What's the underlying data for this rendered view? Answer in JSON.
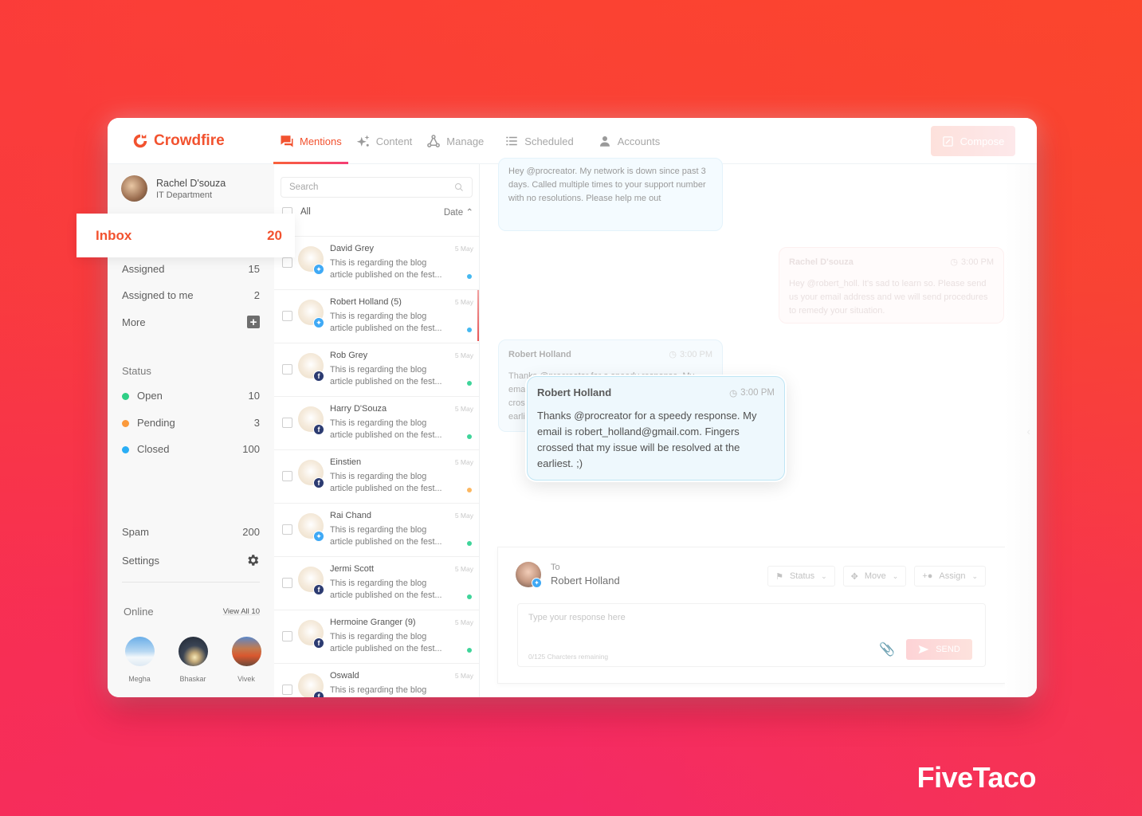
{
  "app": {
    "name": "Crowdfire",
    "nav": [
      {
        "label": "Mentions",
        "icon": "chat-bubbles-icon",
        "active": true
      },
      {
        "label": "Content",
        "icon": "sparkle-icon",
        "active": false
      },
      {
        "label": "Manage",
        "icon": "network-icon",
        "active": false
      },
      {
        "label": "Scheduled",
        "icon": "list-icon",
        "active": false
      },
      {
        "label": "Accounts",
        "icon": "user-icon",
        "active": false
      }
    ],
    "compose_label": "Compose"
  },
  "user": {
    "name": "Rachel D'souza",
    "department": "IT Department"
  },
  "sidebar": {
    "inbox": {
      "label": "Inbox",
      "count": "20"
    },
    "items": [
      {
        "label": "Assigned",
        "count": "15"
      },
      {
        "label": "Assigned to me",
        "count": "2"
      },
      {
        "label": "More",
        "count": "+"
      }
    ],
    "status_heading": "Status",
    "statuses": [
      {
        "label": "Open",
        "count": "10",
        "color": "#2fcf86"
      },
      {
        "label": "Pending",
        "count": "3",
        "color": "#fb9a3c"
      },
      {
        "label": "Closed",
        "count": "100",
        "color": "#2aaef5"
      }
    ],
    "spam": {
      "label": "Spam",
      "count": "200"
    },
    "settings": {
      "label": "Settings"
    },
    "online": {
      "label": "Online",
      "view_all": "View All 10",
      "users": [
        {
          "name": "Megha"
        },
        {
          "name": "Bhaskar"
        },
        {
          "name": "Vivek"
        }
      ]
    }
  },
  "list": {
    "search_placeholder": "Search",
    "all_label": "All",
    "sort_label": "Date",
    "messages": [
      {
        "name": "David Grey",
        "date": "5 May",
        "line1": "This is regarding the blog",
        "line2": "article published on the fest...",
        "network": "twitter",
        "dot": "#45b8f0",
        "selected": false
      },
      {
        "name": "Robert Holland (5)",
        "date": "5 May",
        "line1": "This is regarding the blog",
        "line2": "article published on the fest...",
        "network": "twitter",
        "dot": "#45b8f0",
        "selected": true
      },
      {
        "name": "Rob Grey",
        "date": "5 May",
        "line1": "This is regarding the blog",
        "line2": "article published on the fest...",
        "network": "facebook",
        "dot": "#3fd49a",
        "selected": false
      },
      {
        "name": "Harry D'Souza",
        "date": "5 May",
        "line1": "This is regarding the blog",
        "line2": "article published on the fest...",
        "network": "facebook",
        "dot": "#3fd49a",
        "selected": false
      },
      {
        "name": "Einstien",
        "date": "5 May",
        "line1": "This is regarding the blog",
        "line2": "article published on the fest...",
        "network": "facebook",
        "dot": "#fcb760",
        "selected": false
      },
      {
        "name": "Rai Chand",
        "date": "5 May",
        "line1": "This is regarding the blog",
        "line2": "article published on the fest...",
        "network": "twitter",
        "dot": "#3fd49a",
        "selected": false
      },
      {
        "name": "Jermi Scott",
        "date": "5 May",
        "line1": "This is regarding the blog",
        "line2": "article published on the fest...",
        "network": "facebook",
        "dot": "#3fd49a",
        "selected": false
      },
      {
        "name": "Hermoine Granger (9)",
        "date": "5 May",
        "line1": "This is regarding the blog",
        "line2": "article published on the fest...",
        "network": "facebook",
        "dot": "#3fd49a",
        "selected": false
      },
      {
        "name": "Oswald",
        "date": "5 May",
        "line1": "This is regarding the blog",
        "line2": "",
        "network": "facebook",
        "dot": "",
        "selected": false
      }
    ]
  },
  "conversation": {
    "first_message": "Hey @procreator. My network is down since past 3 days. Called multiple times to your support number with no resolutions. Please help me out",
    "agent_reply": {
      "author": "Rachel D'souza",
      "time": "3:00 PM",
      "text": "Hey @robert_holl. It's sad to learn so. Please send us your email address and we will send procedures to remedy your situation."
    },
    "background_reply": {
      "author": "Robert Holland",
      "time": "3:00 PM",
      "text": "Thanks @procreator for a speedy response. My email is robert_holland@gmail.com. Fingers crossed that my issue will be resolved at the earliest. ;)"
    },
    "highlight": {
      "author": "Robert Holland",
      "time": "3:00 PM",
      "text": "Thanks @procreator for a speedy response. My email is robert_holland@gmail.com. Fingers crossed that my issue will be resolved at the earliest. ;)"
    }
  },
  "reply": {
    "to_label": "To",
    "to_name": "Robert Holland",
    "actions": [
      {
        "label": "Status",
        "icon": "flag-icon"
      },
      {
        "label": "Move",
        "icon": "move-icon"
      },
      {
        "label": "Assign",
        "icon": "add-user-icon"
      }
    ],
    "placeholder": "Type your response here",
    "char_count": "0/125 Charcters remaining",
    "send_label": "SEND"
  },
  "watermark": "FiveTaco"
}
